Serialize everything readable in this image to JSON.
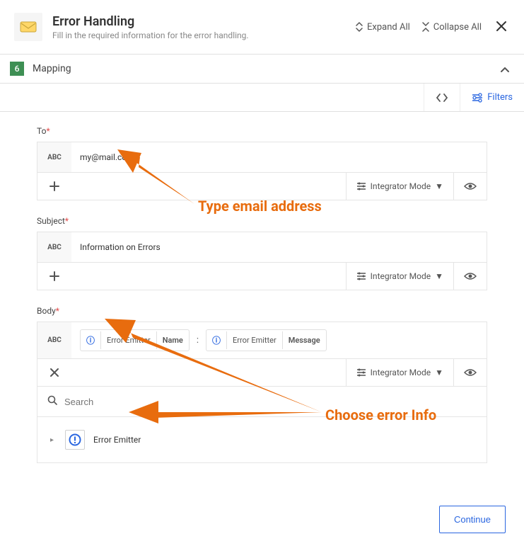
{
  "header": {
    "title": "Error Handling",
    "subtitle": "Fill in the required information for the error handling.",
    "expand": "Expand All",
    "collapse": "Collapse All"
  },
  "section": {
    "step": "6",
    "title": "Mapping",
    "filters": "Filters"
  },
  "fields": {
    "to": {
      "label": "To",
      "value": "my@mail.com",
      "mode": "Integrator Mode"
    },
    "subject": {
      "label": "Subject",
      "value": "Information on Errors",
      "mode": "Integrator Mode"
    },
    "body": {
      "label": "Body",
      "tag1a": "Error Emitter",
      "tag1b": "Name",
      "tag2a": "Error Emitter",
      "tag2b": "Message",
      "mode": "Integrator Mode",
      "search_ph": "Search",
      "emitter": "Error Emitter"
    }
  },
  "footer": {
    "continue": "Continue"
  },
  "abc": "ABC",
  "annotations": {
    "a1": "Type email address",
    "a2": "Choose error Info"
  }
}
